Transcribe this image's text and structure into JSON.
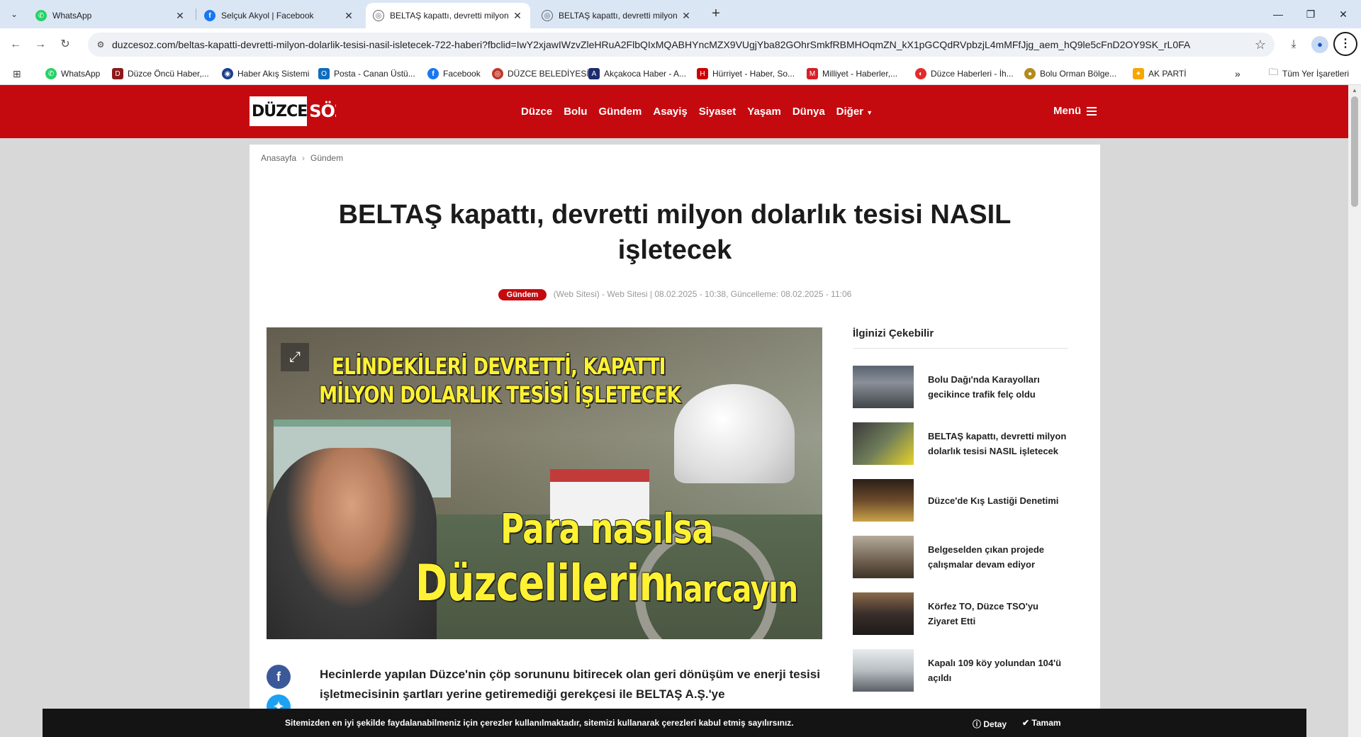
{
  "tabs": [
    {
      "title": "WhatsApp",
      "icon": "whatsapp-icon",
      "color": "#25d366",
      "glyph": "✆"
    },
    {
      "title": "Selçuk Akyol | Facebook",
      "icon": "facebook-icon",
      "color": "#1877f2",
      "glyph": "f"
    },
    {
      "title": "BELTAŞ kapattı, devretti milyon",
      "icon": "globe-icon",
      "color": "#5f6368",
      "glyph": "◎"
    },
    {
      "title": "BELTAŞ kapattı, devretti milyon",
      "icon": "globe-icon",
      "color": "#5f6368",
      "glyph": "◎"
    }
  ],
  "url": "duzcesoz.com/beltas-kapatti-devretti-milyon-dolarlik-tesisi-nasil-isletecek-722-haberi?fbclid=IwY2xjawIWzvZleHRuA2FlbQIxMQABHYncMZX9VUgjYba82GOhrSmkfRBMHOqmZN_kX1pGCQdRVpbzjL4mMFfJjg_aem_hQ9le5cFnD2OY9SK_rL0FA",
  "bookmarks": [
    {
      "label": "WhatsApp",
      "color": "#25d366",
      "glyph": "✆"
    },
    {
      "label": "Düzce Öncü Haber,...",
      "color": "#8b1a1a",
      "glyph": "D"
    },
    {
      "label": "Haber Akış Sistemi",
      "color": "#1a3f8b",
      "glyph": "◉"
    },
    {
      "label": "Posta - Canan Üstü...",
      "color": "#0f6cbd",
      "glyph": "O"
    },
    {
      "label": "Facebook",
      "color": "#1877f2",
      "glyph": "f"
    },
    {
      "label": "DÜZCE BELEDİYESİ",
      "color": "#c0392b",
      "glyph": "◎"
    },
    {
      "label": "Akçakoca Haber - A...",
      "color": "#1d2c6e",
      "glyph": "A"
    },
    {
      "label": "Hürriyet - Haber, So...",
      "color": "#c00",
      "glyph": "H"
    },
    {
      "label": "Milliyet - Haberler,...",
      "color": "#d61f26",
      "glyph": "M"
    },
    {
      "label": "Düzce Haberleri - İh...",
      "color": "#e32b2b",
      "glyph": "◐"
    },
    {
      "label": "Bolu Orman Bölge...",
      "color": "#b38a1c",
      "glyph": "●"
    },
    {
      "label": "AK PARTİ",
      "color": "#f7a600",
      "glyph": "✦"
    }
  ],
  "all_bookmarks": "Tüm Yer İşaretleri",
  "logo": {
    "part1": "DÜZCE",
    "part2": "SÖZ"
  },
  "nav": [
    "Düzce",
    "Bolu",
    "Gündem",
    "Asayiş",
    "Siyaset",
    "Yaşam",
    "Dünya",
    "Diğer"
  ],
  "menu_label": "Menü",
  "breadcrumb": {
    "home": "Anasayfa",
    "current": "Gündem"
  },
  "article": {
    "title": "BELTAŞ kapattı, devretti milyon dolarlık tesisi NASIL işletecek",
    "category": "Gündem",
    "meta": "(Web Sitesi) - Web Sitesi | 08.02.2025 - 10:38, Güncelleme: 08.02.2025 - 11:06",
    "hero_text": {
      "line1": "ELİNDEKİLERİ DEVRETTİ, KAPATTI",
      "line2": "MİLYON DOLARLIK TESİSİ İŞLETECEK",
      "line3": "Para nasılsa",
      "line4": "Düzcelilerin",
      "line5": "harcayın"
    },
    "lead": "Hecinlerde yapılan Düzce'nin çöp sorununu bitirecek olan geri dönüşüm ve enerji tesisi işletmecisinin şartları yerine getiremediği gerekçesi ile BELTAŞ A.Ş.'ye"
  },
  "sidebar": {
    "title": "İlginizi Çekebilir",
    "items": [
      {
        "text": "Bolu Dağı'nda Karayolları gecikince trafik felç oldu",
        "thumb": "linear-gradient(180deg,#5a6470,#8a8f98 40%,#3f4548)"
      },
      {
        "text": "BELTAŞ kapattı, devretti milyon dolarlık tesisi NASIL işletecek",
        "thumb": "linear-gradient(135deg,#3b3b3b,#6f7d5a 50%,#e8d22a)"
      },
      {
        "text": "Düzce'de Kış Lastiği Denetimi",
        "thumb": "linear-gradient(180deg,#2a1f18,#6b4a2a 50%,#c9a248)"
      },
      {
        "text": "Belgeselden çıkan projede çalışmalar devam ediyor",
        "thumb": "linear-gradient(180deg,#b5aa9a,#6e5f4f 60%,#3e3328)"
      },
      {
        "text": "Körfez TO, Düzce TSO'yu Ziyaret Etti",
        "thumb": "linear-gradient(180deg,#8a6a4a,#3a2e2a 50%,#1e1a1a)"
      },
      {
        "text": "Kapalı 109 köy yolundan 104'ü açıldı",
        "thumb": "linear-gradient(180deg,#e8ecef,#b8bec2 50%,#5a6066)"
      }
    ]
  },
  "cookie": {
    "text": "Sitemizden en iyi şekilde faydalanabilmeniz için çerezler kullanılmaktadır, sitemizi kullanarak çerezleri kabul etmiş sayılırsınız.",
    "detail": "Detay",
    "ok": "Tamam"
  }
}
